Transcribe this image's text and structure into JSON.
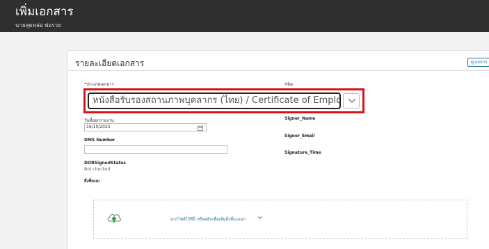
{
  "header": {
    "title": "เพิ่มเอกสาร",
    "subtitle": "นายสุดหล่อ พ่อรวย"
  },
  "section": {
    "title": "รายละเอียดเอกสาร",
    "view_button": "ดูเอกสาร"
  },
  "form": {
    "doc_type_label": "*ประเภทเอกสาร",
    "doc_type_value": "หนังสือรับรองสถานภาพบุคลากร (ไทย) / Certificate of Employment",
    "kind_label": "ชนิด",
    "date_label": "วันที่ออกรายงาน",
    "date_value": "16/10/2025",
    "dms_label": "DMS Number",
    "dms_value": "",
    "signer_name_label": "Signer_Name",
    "signer_email_label": "Signer_Email",
    "signature_time_label": "Signature_Time",
    "dor_label": "DORSignedStatus",
    "dor_value": "Not checked",
    "attachment_label": "สิ่งที่แนบ",
    "dropzone_text": "ลากไฟล์ไว้ที่นี่ หรือคลิกเพื่อเพิ่มสิ่งที่แนบมา"
  },
  "colors": {
    "header_bg": "#2f2f2f",
    "highlight": "#d7131a",
    "link": "#1f6f9f",
    "upload_icon": "#1e9e3e"
  },
  "icons": {
    "dropdown": "chevron-down-icon",
    "calendar": "calendar-icon",
    "upload": "cloud-upload-icon"
  }
}
